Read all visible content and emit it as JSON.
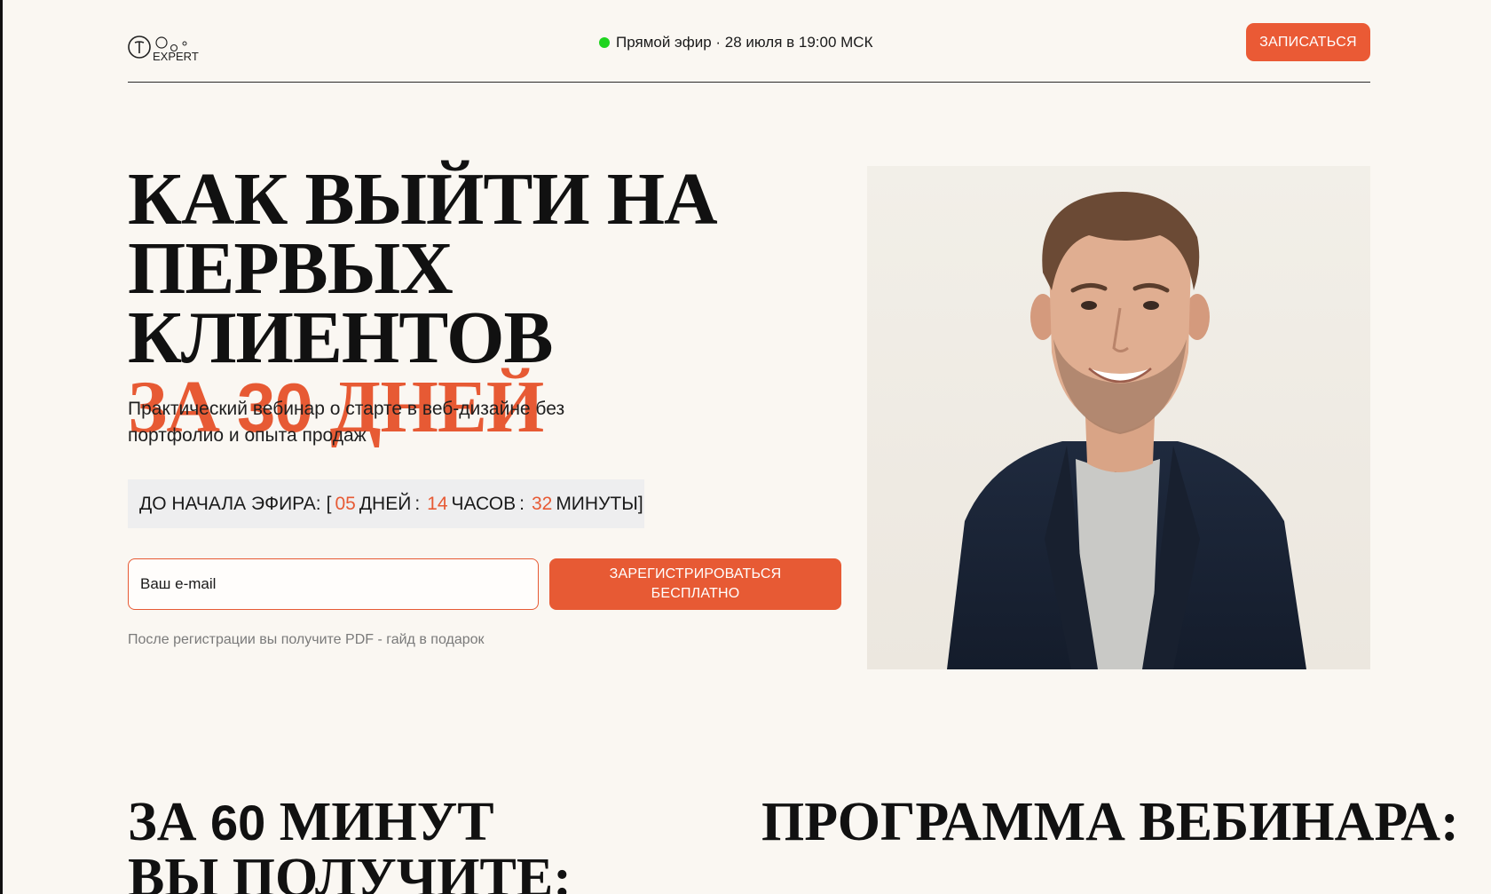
{
  "header": {
    "logo_text": "EXPERT",
    "live_text": "Прямой эфир · 28 июля в 19:00 МСК",
    "cta_label": "ЗАПИСАТЬСЯ"
  },
  "hero": {
    "title_line1": "КАК ВЫЙТИ НА",
    "title_line2": "ПЕРВЫХ КЛИЕНТОВ",
    "title_line3_pre": "ЗА ",
    "title_line3_num": "30",
    "title_line3_post": " ДНЕЙ",
    "subtitle": "Практический вебинар о старте в веб-дизайне без портфолио и опыта продаж",
    "countdown": {
      "label": "ДО НАЧАЛА ЭФИРА:",
      "open": "[",
      "days": "05",
      "days_label": "ДНЕЙ",
      "hours": "14",
      "hours_label": "ЧАСОВ",
      "minutes": "32",
      "minutes_label": "МИНУТЫ",
      "close": "]",
      "separator": ":"
    },
    "email_placeholder": "Ваш e-mail",
    "register_line1": "ЗАРЕГИСТРИРОВАТЬСЯ",
    "register_line2": "БЕСПЛАТНО",
    "note": "После регистрации вы получите PDF - гайд в подарок"
  },
  "section": {
    "left_pre": "ЗА ",
    "left_num": "60",
    "left_post": " МИНУТ",
    "left_line2": "ВЫ ПОЛУЧИТЕ:",
    "right_title": "ПРОГРАММА ВЕБИНАРА:"
  },
  "colors": {
    "accent": "#e75a34",
    "live_dot": "#1fd41f",
    "background": "#faf7f2"
  }
}
